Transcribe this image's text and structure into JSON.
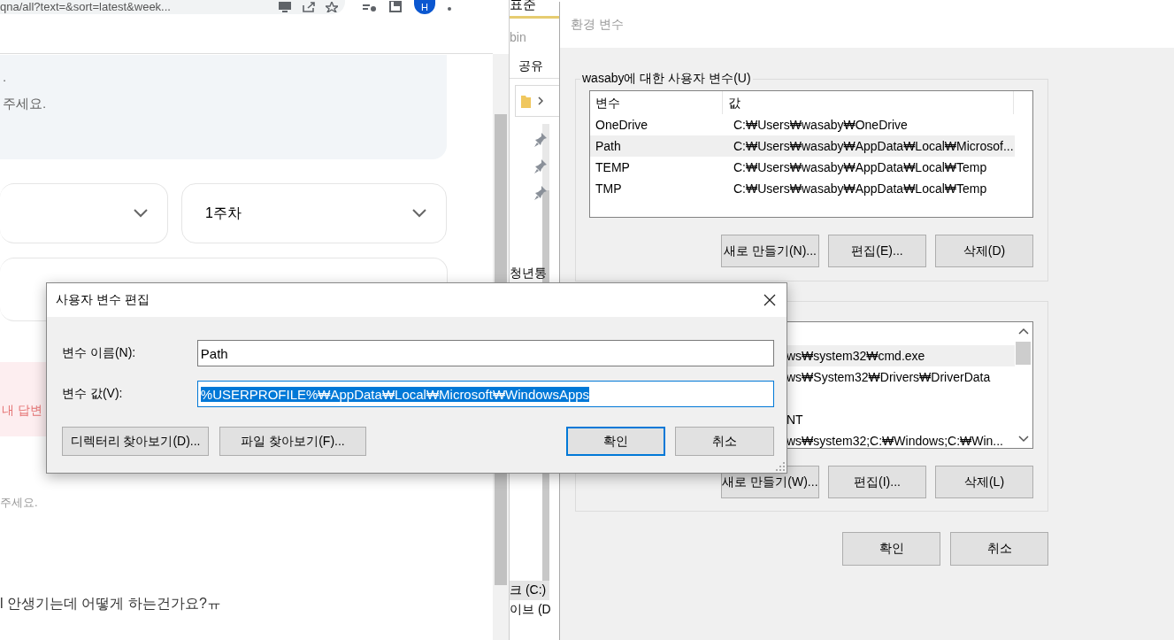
{
  "browser": {
    "url": "qna/all?text=&sort=latest&week...",
    "avatar": "H",
    "notice_lines": [
      ".",
      "주세요."
    ],
    "week_dropdown": {
      "value": "1주차"
    },
    "alert_text": "내 답변",
    "hint": "주세요.",
    "question": "l 안생기는데 어떻게 하는건가요?ㅠ"
  },
  "explorer": {
    "title": "표준",
    "path": "bin",
    "tab": "공유",
    "items": [
      {
        "label": "청년통",
        "selected": false
      },
      {
        "label": "크 (C:)",
        "selected": true
      },
      {
        "label": "이브 (D",
        "selected": false
      }
    ]
  },
  "env_window": {
    "title": "환경 변수",
    "user_group": {
      "label": "wasaby에 대한 사용자 변수(U)",
      "columns": [
        "변수",
        "값"
      ],
      "rows": [
        {
          "name": "OneDrive",
          "value": "C:₩Users₩wasaby₩OneDrive",
          "selected": false
        },
        {
          "name": "Path",
          "value": "C:₩Users₩wasaby₩AppData₩Local₩Microsof...",
          "selected": true
        },
        {
          "name": "TEMP",
          "value": "C:₩Users₩wasaby₩AppData₩Local₩Temp",
          "selected": false
        },
        {
          "name": "TMP",
          "value": "C:₩Users₩wasaby₩AppData₩Local₩Temp",
          "selected": false
        }
      ],
      "buttons": [
        "새로 만들기(N)...",
        "편집(E)...",
        "삭제(D)"
      ]
    },
    "system_group": {
      "rows": [
        {
          "value": "ws₩system32₩cmd.exe",
          "selected": true
        },
        {
          "value": "ws₩System32₩Drivers₩DriverData",
          "selected": false
        },
        {
          "selected": false
        },
        {
          "value": "NT",
          "selected": false
        },
        {
          "value": "ws₩system32;C:₩Windows;C:₩Win...",
          "selected": false
        }
      ],
      "buttons": [
        "새로 만들기(W)...",
        "편집(I)...",
        "삭제(L)"
      ]
    },
    "buttons": [
      "확인",
      "취소"
    ]
  },
  "edit_dialog": {
    "title": "사용자 변수 편집",
    "fields": [
      {
        "label": "변수 이름(N):",
        "value": "Path",
        "focused": false
      },
      {
        "label": "변수 값(V):",
        "value": "%USERPROFILE%₩AppData₩Local₩Microsoft₩WindowsApps",
        "focused": true
      }
    ],
    "browse_buttons": [
      "디렉터리 찾아보기(D)...",
      "파일 찾아보기(F)..."
    ],
    "buttons": [
      {
        "label": "확인",
        "default": true
      },
      {
        "label": "취소",
        "default": false
      }
    ]
  }
}
